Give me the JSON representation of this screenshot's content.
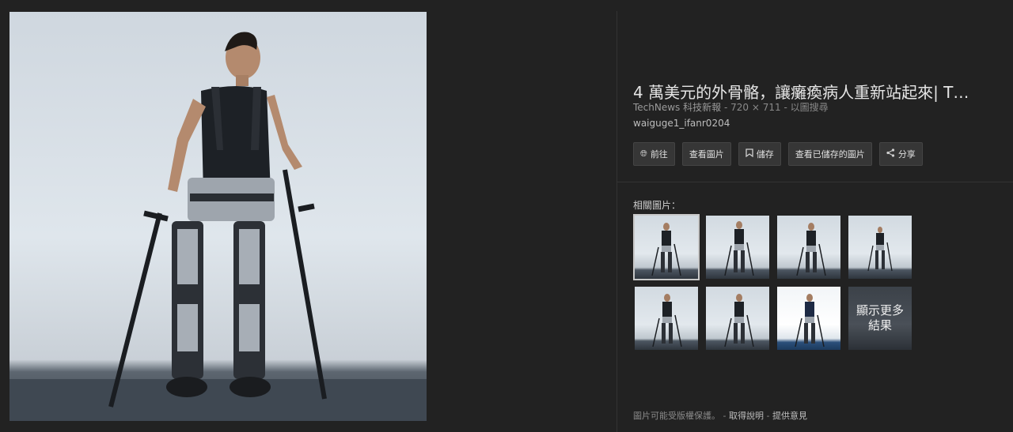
{
  "title": "4 萬美元的外骨骼，讓癱瘓病人重新站起來| T…",
  "meta": {
    "source": "TechNews 科技新報",
    "dimensions": "720 × 711",
    "search_by_image": "以圖搜尋",
    "sep": "-"
  },
  "filename": "waiguge1_ifanr0204",
  "actions": [
    {
      "label": "前往",
      "icon": "globe-icon"
    },
    {
      "label": "查看圖片",
      "icon": ""
    },
    {
      "label": "儲存",
      "icon": "bookmark-icon"
    },
    {
      "label": "查看已儲存的圖片",
      "icon": ""
    },
    {
      "label": "分享",
      "icon": "share-icon"
    }
  ],
  "related": {
    "label": "相關圖片：",
    "more_label": "顯示更多結果"
  },
  "footer": {
    "notice": "圖片可能受版權保護。",
    "sep": "-",
    "help": "取得說明",
    "feedback": "提供意見"
  },
  "colors": {
    "background": "#222222",
    "button": "#363636",
    "accent_text": "#e6e6e6"
  }
}
